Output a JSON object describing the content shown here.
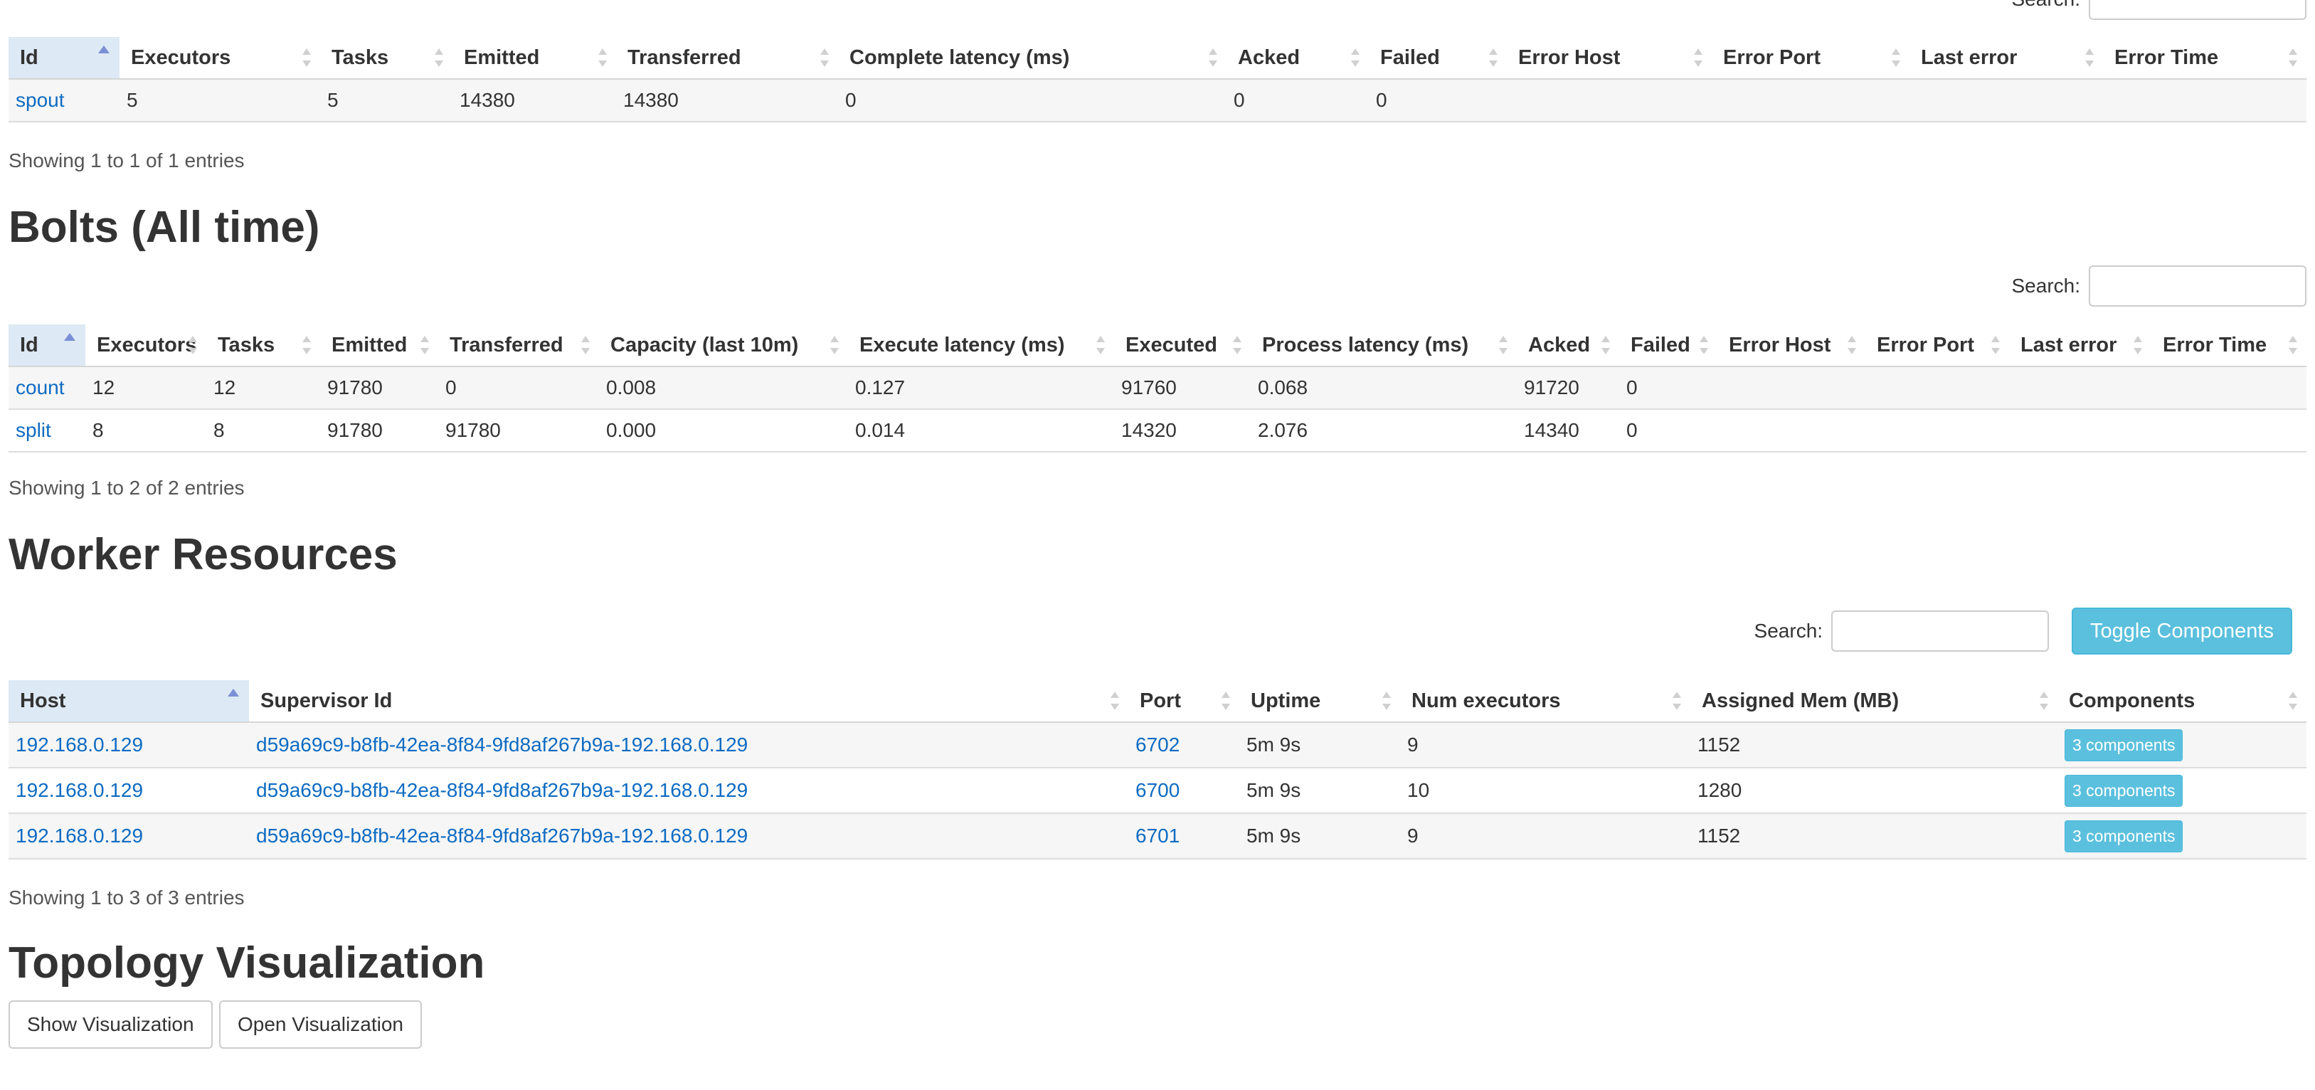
{
  "spouts": {
    "search_label": "Search:",
    "columns": [
      "Id",
      "Executors",
      "Tasks",
      "Emitted",
      "Transferred",
      "Complete latency (ms)",
      "Acked",
      "Failed",
      "Error Host",
      "Error Port",
      "Last error",
      "Error Time"
    ],
    "rows": [
      [
        "spout",
        "5",
        "5",
        "14380",
        "14380",
        "0",
        "0",
        "0",
        "",
        "",
        "",
        ""
      ]
    ],
    "info": "Showing 1 to 1 of 1 entries"
  },
  "bolts": {
    "heading": "Bolts (All time)",
    "search_label": "Search:",
    "columns": [
      "Id",
      "Executors",
      "Tasks",
      "Emitted",
      "Transferred",
      "Capacity (last 10m)",
      "Execute latency (ms)",
      "Executed",
      "Process latency (ms)",
      "Acked",
      "Failed",
      "Error Host",
      "Error Port",
      "Last error",
      "Error Time"
    ],
    "rows": [
      [
        "count",
        "12",
        "12",
        "91780",
        "0",
        "0.008",
        "0.127",
        "91760",
        "0.068",
        "91720",
        "0",
        "",
        "",
        "",
        ""
      ],
      [
        "split",
        "8",
        "8",
        "91780",
        "91780",
        "0.000",
        "0.014",
        "14320",
        "2.076",
        "14340",
        "0",
        "",
        "",
        "",
        ""
      ]
    ],
    "info": "Showing 1 to 2 of 2 entries"
  },
  "workers": {
    "heading": "Worker Resources",
    "search_label": "Search:",
    "toggle_label": "Toggle Components",
    "columns": [
      "Host",
      "Supervisor Id",
      "Port",
      "Uptime",
      "Num executors",
      "Assigned Mem (MB)",
      "Components"
    ],
    "rows": [
      [
        "192.168.0.129",
        "d59a69c9-b8fb-42ea-8f84-9fd8af267b9a-192.168.0.129",
        "6702",
        "5m 9s",
        "9",
        "1152",
        "3 components"
      ],
      [
        "192.168.0.129",
        "d59a69c9-b8fb-42ea-8f84-9fd8af267b9a-192.168.0.129",
        "6700",
        "5m 9s",
        "10",
        "1280",
        "3 components"
      ],
      [
        "192.168.0.129",
        "d59a69c9-b8fb-42ea-8f84-9fd8af267b9a-192.168.0.129",
        "6701",
        "5m 9s",
        "9",
        "1152",
        "3 components"
      ]
    ],
    "info": "Showing 1 to 3 of 3 entries"
  },
  "visualization": {
    "heading": "Topology Visualization",
    "show_label": "Show Visualization",
    "open_label": "Open Visualization"
  }
}
